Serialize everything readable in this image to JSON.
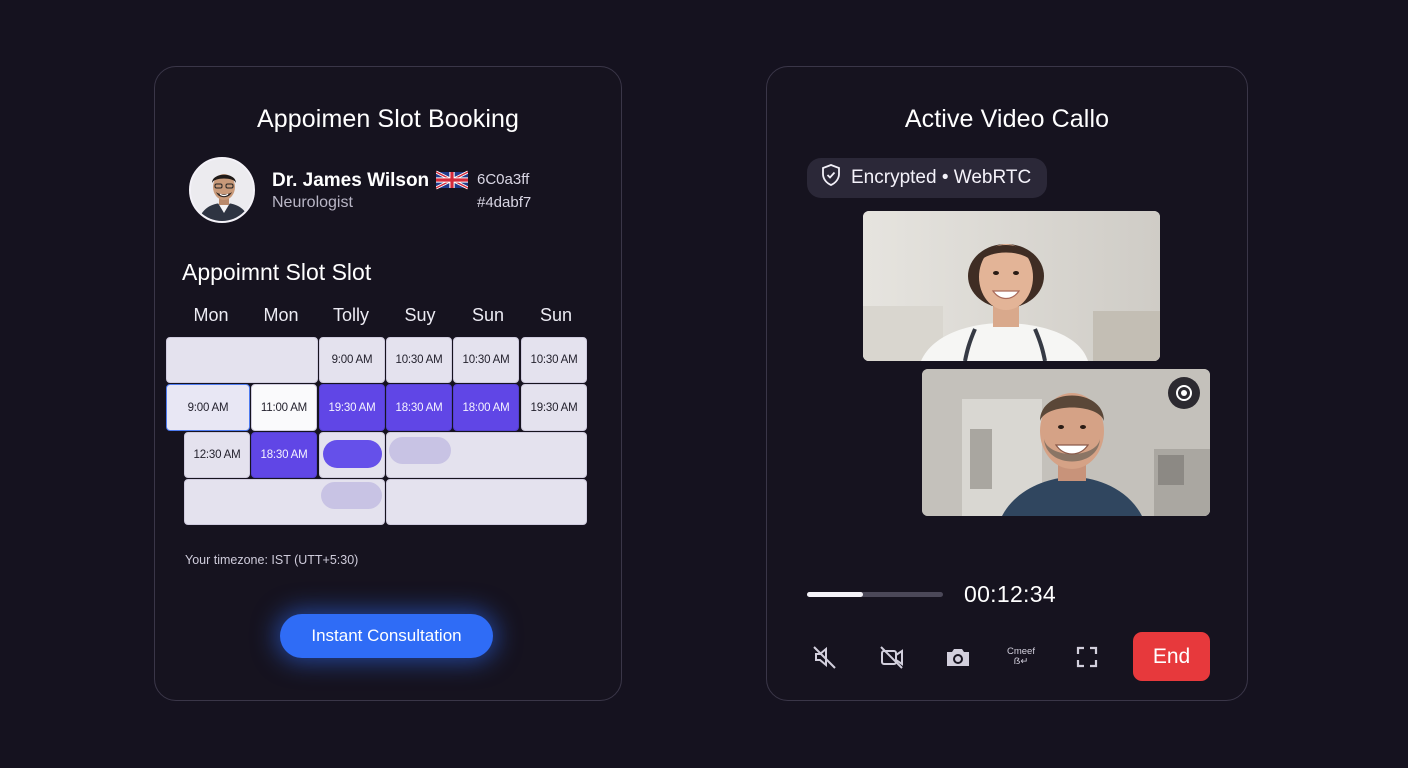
{
  "booking": {
    "title": "Appoimen Slot Booking",
    "doctor": {
      "name": "Dr. James Wilson",
      "specialty": "Neurologist",
      "flag_icon": "uk-flag-icon",
      "code_1": "6C0a3ff",
      "code_2": "#4dabf7"
    },
    "section_title": "Appoimnt Slot Slot",
    "days": [
      "Mon",
      "Mon",
      "Tolly",
      "Suy",
      "Sun",
      "Sun"
    ],
    "slots": {
      "row1": [
        "9:00 AM",
        "10:30 AM",
        "10:30 AM",
        "10:30 AM"
      ],
      "row2": [
        "9:00 AM",
        "11:00 AM",
        "19:30 AM",
        "18:30 AM",
        "18:00 AM",
        "19:30 AM"
      ],
      "row3": [
        "12:30 AM",
        "18:30 AM"
      ]
    },
    "timezone": "Your timezone: IST (UTT+5:30)",
    "cta_label": "Instant Consultation",
    "colors": {
      "selected": "#6046e6",
      "cta": "#2f6cf6"
    }
  },
  "call": {
    "title": "Active Video Callo",
    "badge": "Encrypted • WebRTC",
    "badge_icon": "shield-check-icon",
    "timer": "00:12:34",
    "progress": 0.41,
    "controls": {
      "mute_icon": "mic-off-icon",
      "video_icon": "video-off-icon",
      "camera_icon": "camera-icon",
      "screen_text": "Cmeef ẞ↵",
      "fullscreen_icon": "fullscreen-icon",
      "end_label": "End"
    },
    "colors": {
      "end": "#e7393c"
    }
  }
}
